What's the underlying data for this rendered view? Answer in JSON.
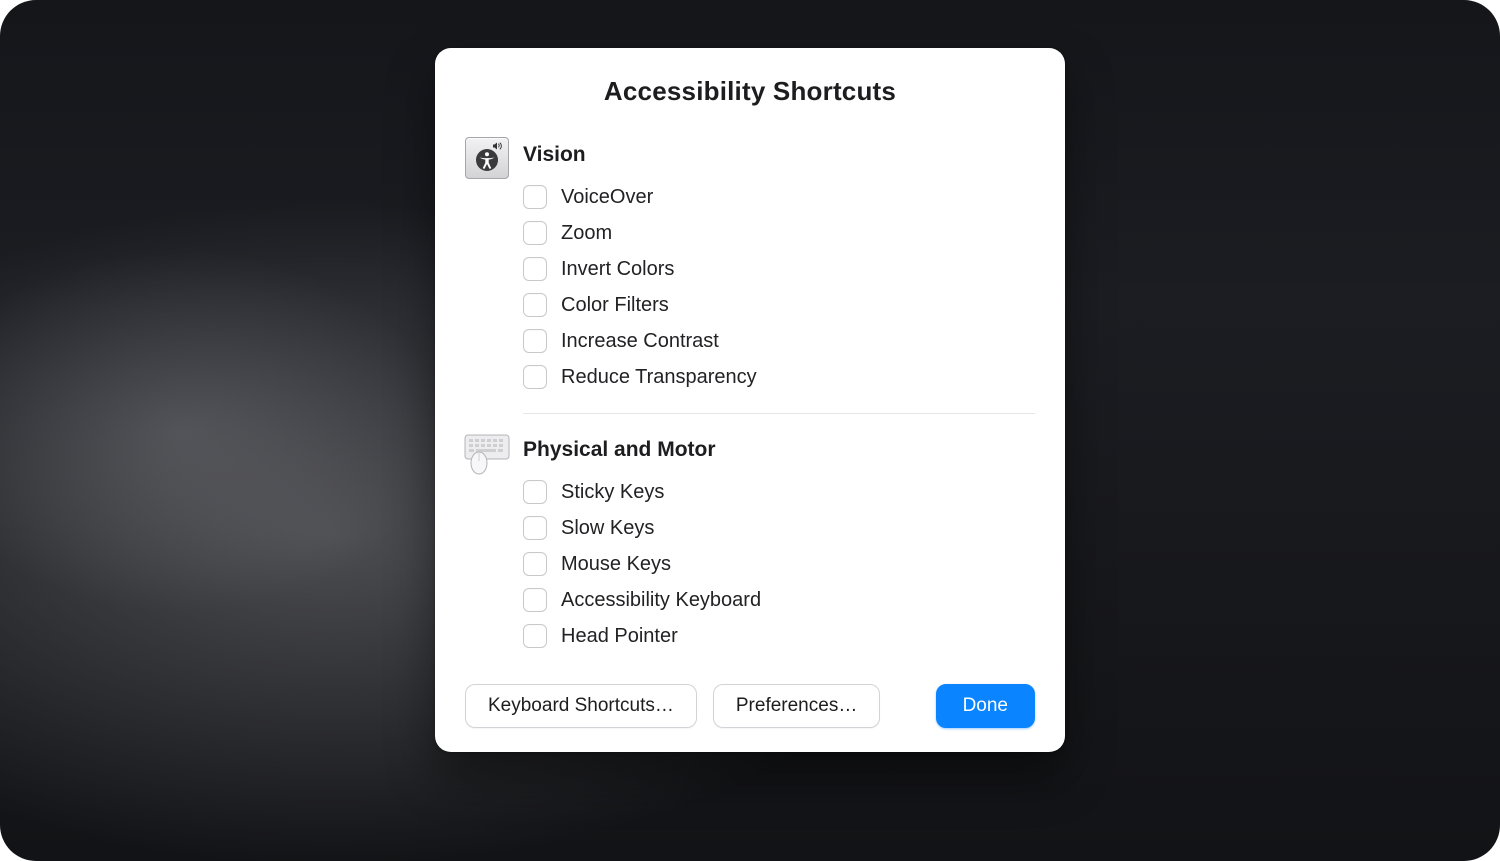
{
  "dialog": {
    "title": "Accessibility Shortcuts"
  },
  "sections": {
    "vision": {
      "title": "Vision",
      "items": [
        {
          "label": "VoiceOver",
          "checked": false
        },
        {
          "label": "Zoom",
          "checked": false
        },
        {
          "label": "Invert Colors",
          "checked": false
        },
        {
          "label": "Color Filters",
          "checked": false
        },
        {
          "label": "Increase Contrast",
          "checked": false
        },
        {
          "label": "Reduce Transparency",
          "checked": false
        }
      ]
    },
    "motor": {
      "title": "Physical and Motor",
      "items": [
        {
          "label": "Sticky Keys",
          "checked": false
        },
        {
          "label": "Slow Keys",
          "checked": false
        },
        {
          "label": "Mouse Keys",
          "checked": false
        },
        {
          "label": "Accessibility Keyboard",
          "checked": false
        },
        {
          "label": "Head Pointer",
          "checked": false
        }
      ]
    }
  },
  "footer": {
    "keyboard_shortcuts": "Keyboard Shortcuts…",
    "preferences": "Preferences…",
    "done": "Done"
  }
}
